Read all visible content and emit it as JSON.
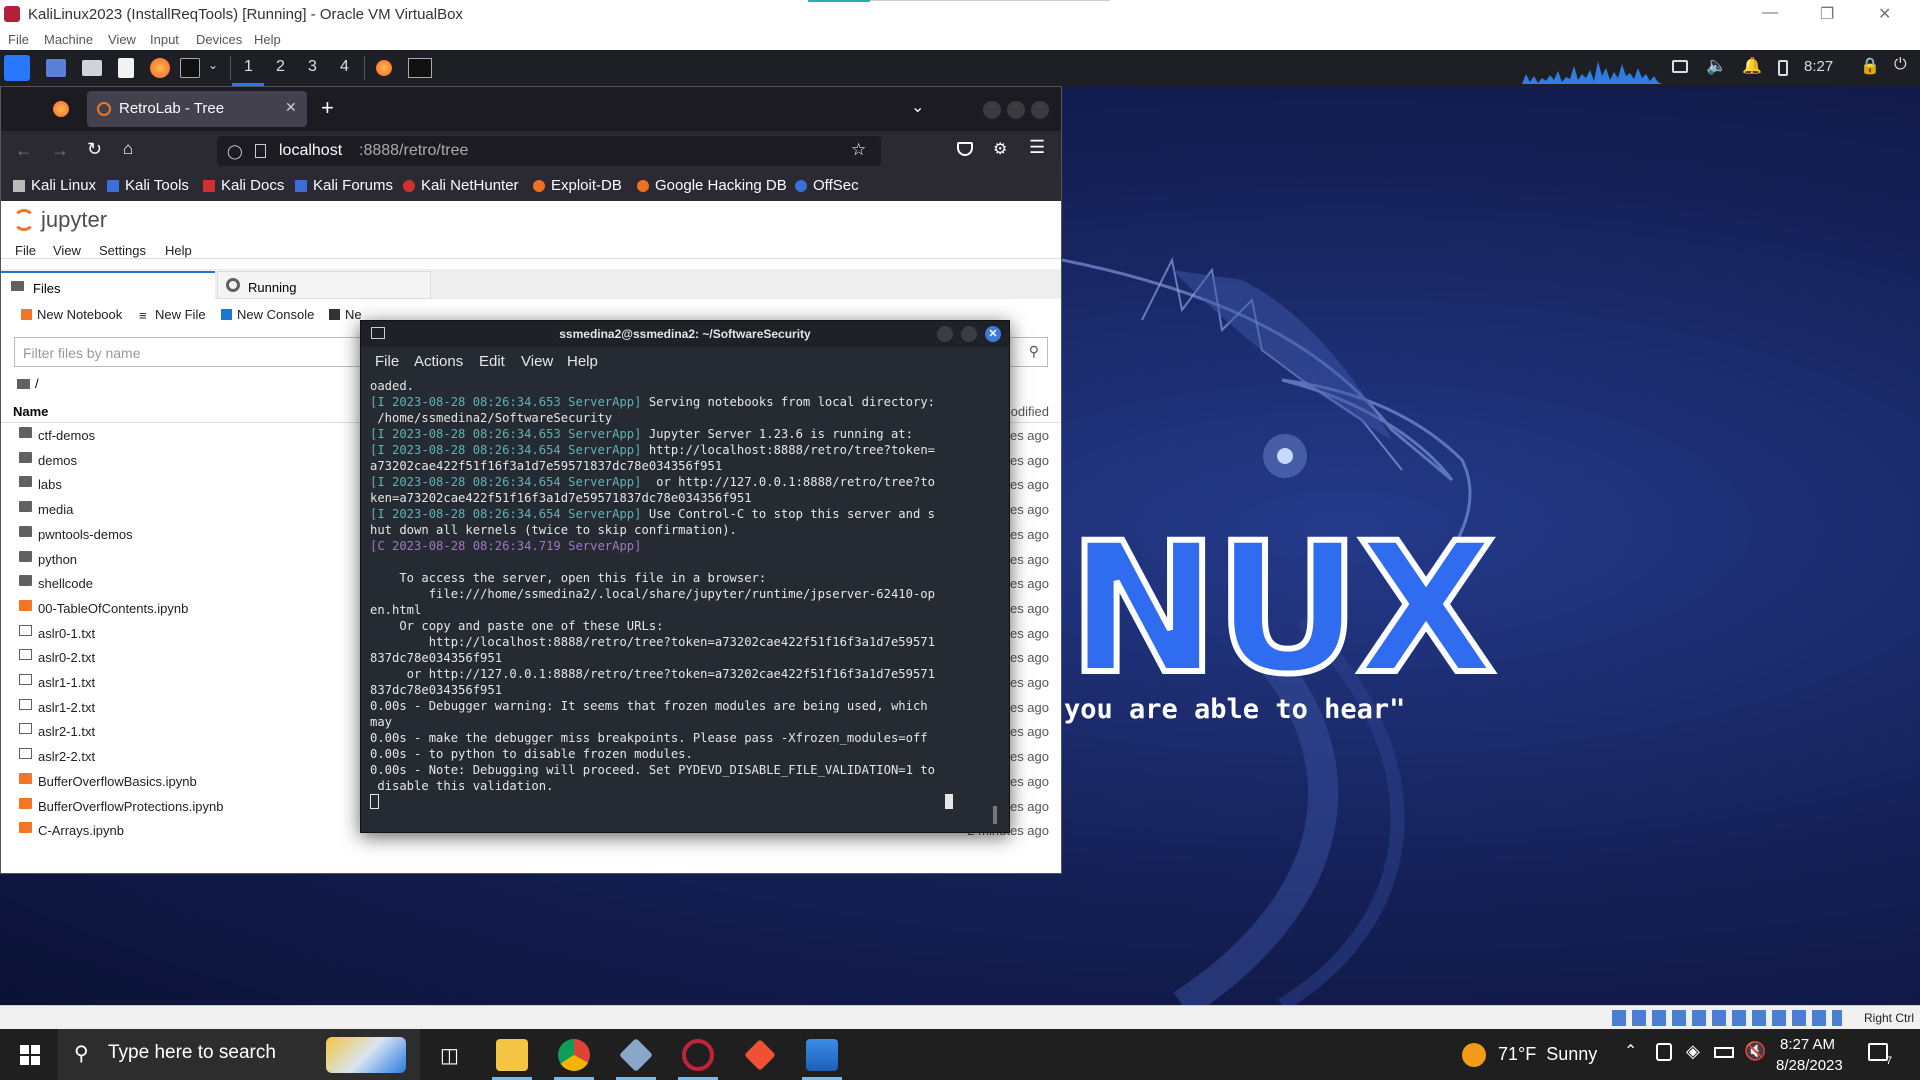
{
  "vbox": {
    "title": "KaliLinux2023 (InstallReqTools) [Running] - Oracle VM VirtualBox",
    "menu": [
      "File",
      "Machine",
      "View",
      "Input",
      "Devices",
      "Help"
    ],
    "host_key": "Right Ctrl"
  },
  "kali_panel": {
    "workspaces": [
      "1",
      "2",
      "3",
      "4"
    ],
    "clock": "8:27"
  },
  "browser": {
    "tab_title": "RetroLab - Tree",
    "url_host": "localhost",
    "url_rest": ":8888/retro/tree",
    "bookmarks": [
      "Kali Linux",
      "Kali Tools",
      "Kali Docs",
      "Kali Forums",
      "Kali NetHunter",
      "Exploit-DB",
      "Google Hacking DB",
      "OffSec"
    ]
  },
  "jupyter": {
    "brand": "jupyter",
    "menu": [
      "File",
      "View",
      "Settings",
      "Help"
    ],
    "tabs": [
      "Files",
      "Running"
    ],
    "toolbar": [
      "New Notebook",
      "New File",
      "New Console",
      "Ne"
    ],
    "filter_placeholder": "Filter files by name",
    "breadcrumb": "/",
    "col_name": "Name",
    "col_modified": "Last Modified",
    "files": [
      {
        "name": "ctf-demos",
        "type": "folder",
        "modified": "2 minutes ago"
      },
      {
        "name": "demos",
        "type": "folder",
        "modified": "2 minutes ago"
      },
      {
        "name": "labs",
        "type": "folder",
        "modified": "2 minutes ago"
      },
      {
        "name": "media",
        "type": "folder",
        "modified": "2 minutes ago"
      },
      {
        "name": "pwntools-demos",
        "type": "folder",
        "modified": "2 minutes ago"
      },
      {
        "name": "python",
        "type": "folder",
        "modified": "2 minutes ago"
      },
      {
        "name": "shellcode",
        "type": "folder",
        "modified": "2 minutes ago"
      },
      {
        "name": "00-TableOfContents.ipynb",
        "type": "notebook",
        "modified": "2 minutes ago"
      },
      {
        "name": "aslr0-1.txt",
        "type": "text",
        "modified": "2 minutes ago"
      },
      {
        "name": "aslr0-2.txt",
        "type": "text",
        "modified": "2 minutes ago"
      },
      {
        "name": "aslr1-1.txt",
        "type": "text",
        "modified": "2 minutes ago"
      },
      {
        "name": "aslr1-2.txt",
        "type": "text",
        "modified": "2 minutes ago"
      },
      {
        "name": "aslr2-1.txt",
        "type": "text",
        "modified": "2 minutes ago"
      },
      {
        "name": "aslr2-2.txt",
        "type": "text",
        "modified": "2 minutes ago"
      },
      {
        "name": "BufferOverflowBasics.ipynb",
        "type": "notebook",
        "modified": "2 minutes ago"
      },
      {
        "name": "BufferOverflowProtections.ipynb",
        "type": "notebook",
        "modified": "2 minutes ago"
      },
      {
        "name": "C-Arrays.ipynb",
        "type": "notebook",
        "modified": "2 minutes ago"
      }
    ]
  },
  "terminal": {
    "title": "ssmedina2@ssmedina2: ~/SoftwareSecurity",
    "menu": [
      "File",
      "Actions",
      "Edit",
      "View",
      "Help"
    ],
    "lines": [
      {
        "t": "oaded.",
        "c": ""
      },
      {
        "p": "[I 2023-08-28 08:26:34.653 ServerApp]",
        "t": " Serving notebooks from local directory:",
        "c": "g"
      },
      {
        "t": " /home/ssmedina2/SoftwareSecurity",
        "c": ""
      },
      {
        "p": "[I 2023-08-28 08:26:34.653 ServerApp]",
        "t": " Jupyter Server 1.23.6 is running at:",
        "c": "g"
      },
      {
        "p": "[I 2023-08-28 08:26:34.654 ServerApp]",
        "t": " http://localhost:8888/retro/tree?token=",
        "c": "g"
      },
      {
        "t": "a73202cae422f51f16f3a1d7e59571837dc78e034356f951",
        "c": ""
      },
      {
        "p": "[I 2023-08-28 08:26:34.654 ServerApp]",
        "t": "  or http://127.0.0.1:8888/retro/tree?to",
        "c": "g"
      },
      {
        "t": "ken=a73202cae422f51f16f3a1d7e59571837dc78e034356f951",
        "c": ""
      },
      {
        "p": "[I 2023-08-28 08:26:34.654 ServerApp]",
        "t": " Use Control-C to stop this server and s",
        "c": "g"
      },
      {
        "t": "hut down all kernels (twice to skip confirmation).",
        "c": ""
      },
      {
        "p": "[C 2023-08-28 08:26:34.719 ServerApp]",
        "t": "",
        "c": "c"
      },
      {
        "t": "",
        "c": ""
      },
      {
        "t": "    To access the server, open this file in a browser:",
        "c": ""
      },
      {
        "t": "        file:///home/ssmedina2/.local/share/jupyter/runtime/jpserver-62410-op",
        "c": ""
      },
      {
        "t": "en.html",
        "c": ""
      },
      {
        "t": "    Or copy and paste one of these URLs:",
        "c": ""
      },
      {
        "t": "        http://localhost:8888/retro/tree?token=a73202cae422f51f16f3a1d7e59571",
        "c": ""
      },
      {
        "t": "837dc78e034356f951",
        "c": ""
      },
      {
        "t": "     or http://127.0.0.1:8888/retro/tree?token=a73202cae422f51f16f3a1d7e59571",
        "c": ""
      },
      {
        "t": "837dc78e034356f951",
        "c": ""
      },
      {
        "t": "0.00s - Debugger warning: It seems that frozen modules are being used, which",
        "c": ""
      },
      {
        "t": "may",
        "c": ""
      },
      {
        "t": "0.00s - make the debugger miss breakpoints. Please pass -Xfrozen_modules=off",
        "c": ""
      },
      {
        "t": "0.00s - to python to disable frozen modules.",
        "c": ""
      },
      {
        "t": "0.00s - Note: Debugging will proceed. Set PYDEVD_DISABLE_FILE_VALIDATION=1 to",
        "c": ""
      },
      {
        "t": " disable this validation.",
        "c": ""
      }
    ]
  },
  "wallpaper": {
    "big_text": "NUX",
    "quote": "you are able to hear\""
  },
  "taskbar": {
    "search_placeholder": "Type here to search",
    "weather": "71°F  Sunny",
    "time": "8:27 AM",
    "date": "8/28/2023",
    "notifications": "7"
  },
  "colors": {
    "kali_blue": "#2777ff",
    "jupyter_orange": "#f37626",
    "terminal_bg": "#262a33",
    "close_blue": "#3c7bd9"
  }
}
